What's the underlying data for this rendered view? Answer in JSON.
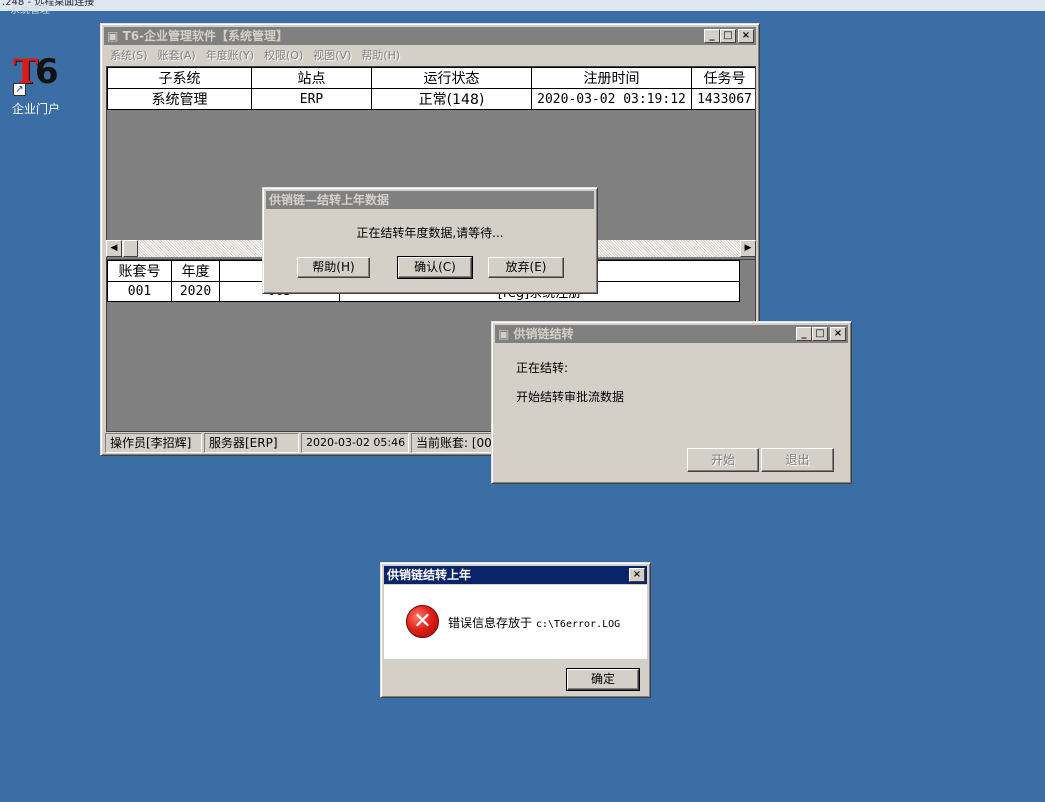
{
  "remote": {
    "title": ".248 - 远程桌面连接",
    "subtitle": "系统管理"
  },
  "desktop_icon": {
    "label": "企业门户",
    "logo_t": "T",
    "logo_6": "6"
  },
  "main": {
    "title": "T6-企业管理软件【系统管理】",
    "menu": [
      "系统(S)",
      "账套(A)",
      "年度账(Y)",
      "权限(O)",
      "视图(V)",
      "帮助(H)"
    ],
    "grid1": {
      "headers": [
        "子系统",
        "站点",
        "运行状态",
        "注册时间",
        "任务号"
      ],
      "rows": [
        [
          "系统管理",
          "ERP",
          "正常(148)",
          "2020-03-02 03:19:12",
          "1433067"
        ]
      ]
    },
    "grid2": {
      "headers": [
        "账套号",
        "年度",
        "操",
        ""
      ],
      "rows": [
        [
          "001",
          "2020",
          "005",
          "[reg]系统注册"
        ]
      ]
    },
    "status": [
      "操作员[李招辉]",
      "服务器[ERP]",
      "2020-03-02 05:46",
      "当前账套: [00"
    ]
  },
  "carry_dialog": {
    "title": "供销链—结转上年数据",
    "message": "正在结转年度数据,请等待...",
    "buttons": [
      "帮助(H)",
      "确认(C)",
      "放弃(E)"
    ]
  },
  "transfer_window": {
    "title": "供销链结转",
    "label_progress": "正在结转:",
    "label_step": "开始结转审批流数据",
    "buttons": [
      "开始",
      "退出"
    ]
  },
  "error_dialog": {
    "title": "供销链结转上年",
    "message": "错误信息存放于",
    "path": "c:\\T6error.LOG",
    "ok": "确定"
  }
}
